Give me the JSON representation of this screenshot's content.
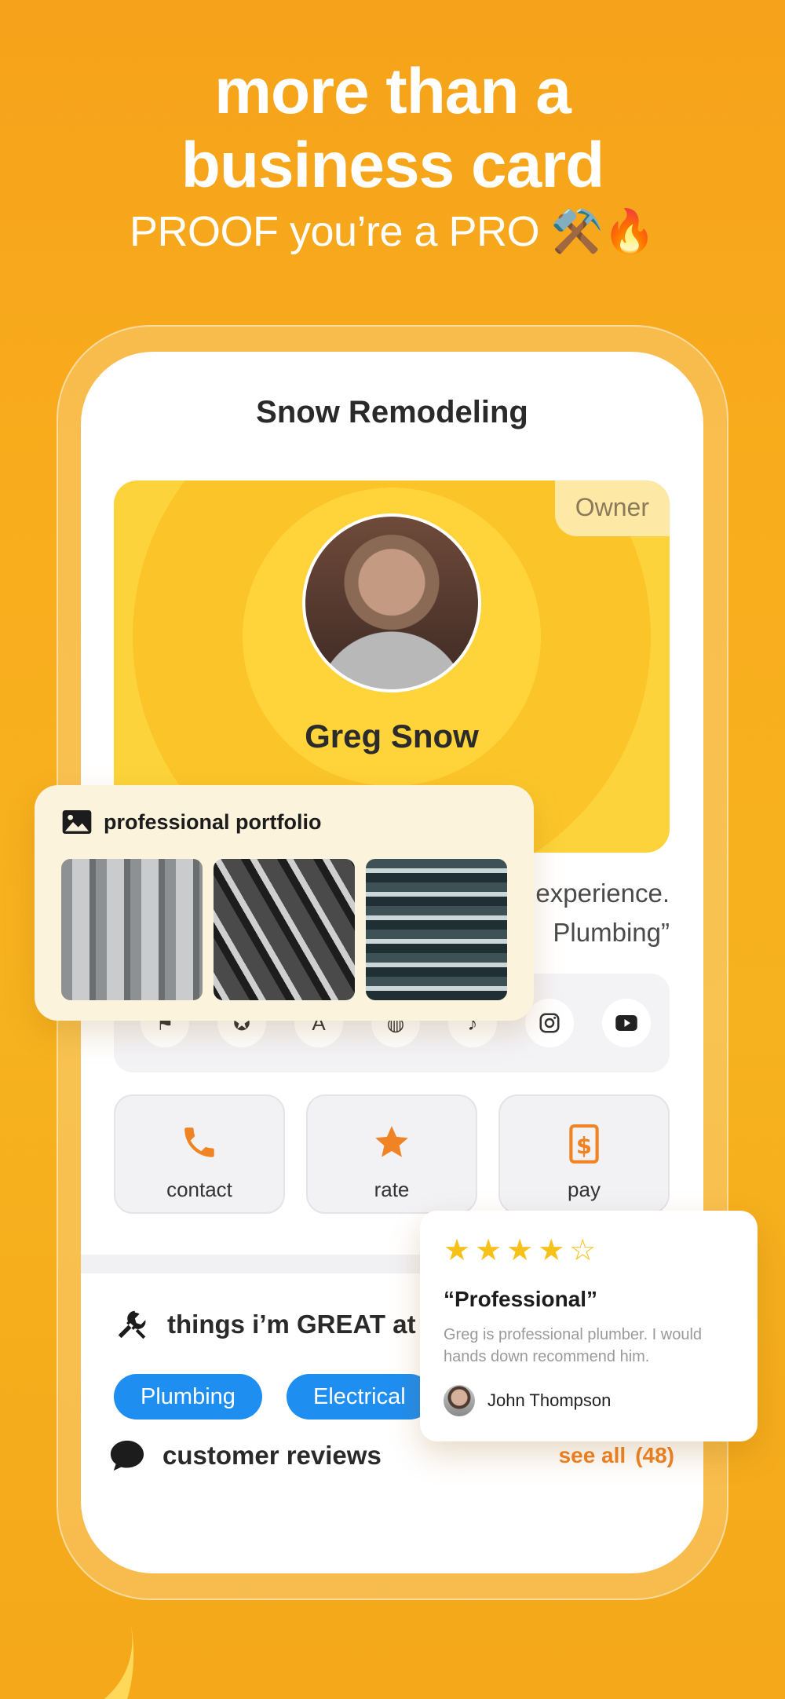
{
  "hero": {
    "title_line1": "more than a",
    "title_line2": "business card",
    "subtitle": "PROOF you’re a PRO ⚒️🔥"
  },
  "phone": {
    "business_name": "Snow Remodeling",
    "profile": {
      "role_badge": "Owner",
      "name": "Greg Snow"
    },
    "bio_lines": [
      "experience.",
      "Plumbing”"
    ],
    "social_icons": [
      "flag-icon",
      "badge-icon",
      "translate-icon",
      "globe-icon",
      "tiktok-icon",
      "instagram-icon",
      "youtube-icon"
    ],
    "actions": [
      {
        "label": "contact",
        "icon": "phone-icon"
      },
      {
        "label": "rate",
        "icon": "star-icon"
      },
      {
        "label": "pay",
        "icon": "dollar-icon"
      }
    ],
    "skills": {
      "heading": "things i’m GREAT at",
      "tags": [
        "Plumbing",
        "Electrical"
      ]
    },
    "reviews": {
      "heading": "customer reviews",
      "see_all": "see all",
      "count": "(48)"
    }
  },
  "portfolio": {
    "heading": "professional portfolio",
    "images": [
      "pipes-photo-1",
      "pipes-photo-2",
      "pipes-photo-3"
    ]
  },
  "review_card": {
    "stars_filled": 4,
    "stars_total": 5,
    "stars_text": "★★★★☆",
    "title": "“Professional”",
    "text": "Greg is professional plumber. I would hands down recommend him.",
    "author": "John Thompson"
  },
  "colors": {
    "background": "#f7ad1d",
    "accent_orange": "#f08324",
    "pill_blue": "#1f8ef1",
    "star_yellow": "#f6c21a"
  }
}
